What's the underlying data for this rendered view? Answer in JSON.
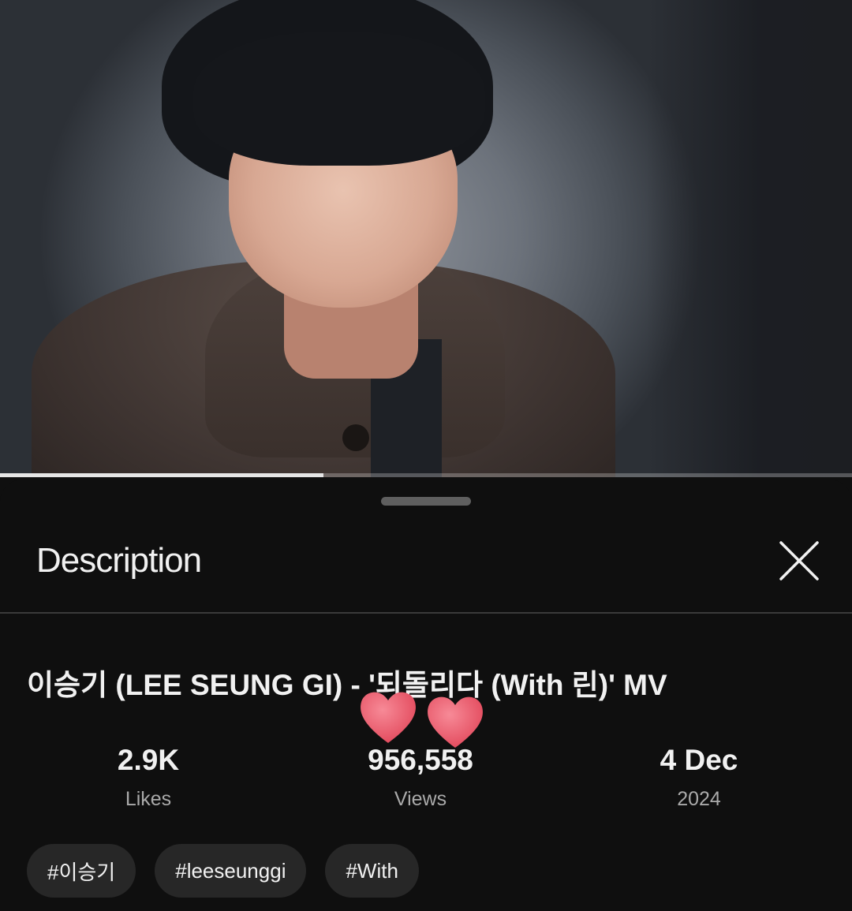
{
  "player": {
    "progress_fraction": 0.38
  },
  "description_sheet": {
    "title": "Description",
    "close_icon": "close-icon",
    "video_title": "이승기 (LEE SEUNG GI) - '되돌리다 (With 린)' MV",
    "stickers": [
      "heart-icon",
      "heart-icon"
    ],
    "stats": [
      {
        "value": "2.9K",
        "label": "Likes"
      },
      {
        "value": "956,558",
        "label": "Views"
      },
      {
        "value": "4 Dec",
        "label": "2024"
      }
    ],
    "hashtags": [
      "#이승기",
      "#leeseunggi",
      "#With"
    ]
  },
  "colors": {
    "background": "#0f0f0f",
    "chip": "#272727",
    "heart": "#ee5a6b",
    "secondary_text": "#aaaaaa"
  }
}
